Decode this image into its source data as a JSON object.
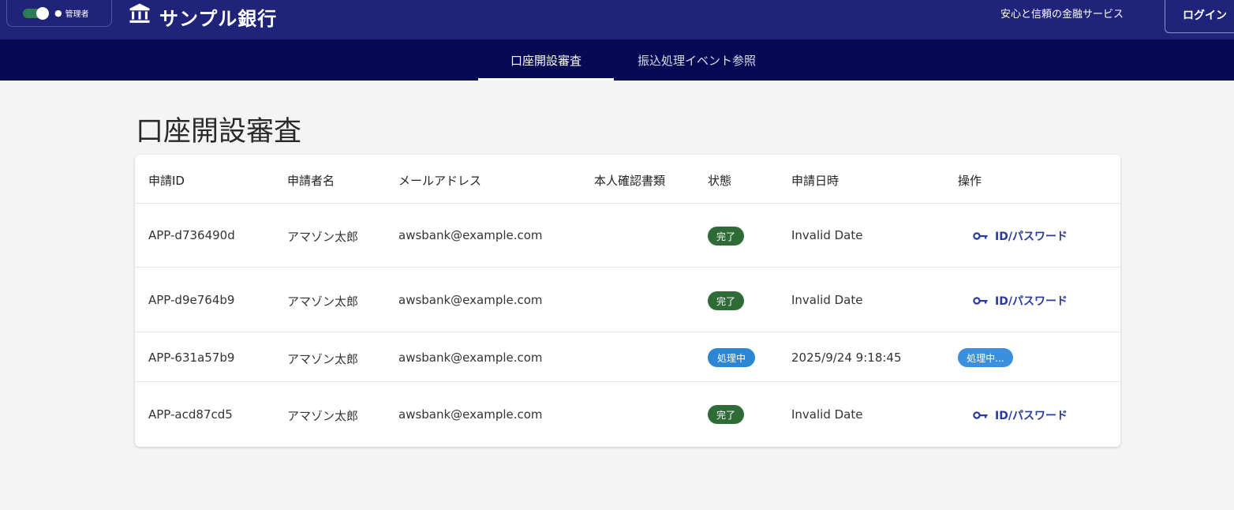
{
  "header": {
    "admin_label": "管理者",
    "brand": "サンプル銀行",
    "tagline": "安心と信頼の金融サービス",
    "login_label": "ログイン"
  },
  "nav": {
    "tabs": [
      {
        "label": "口座開設審査",
        "active": true
      },
      {
        "label": "振込処理イベント参照",
        "active": false
      }
    ]
  },
  "page": {
    "title": "口座開設審査"
  },
  "table": {
    "columns": [
      "申請ID",
      "申請者名",
      "メールアドレス",
      "本人確認書類",
      "状態",
      "申請日時",
      "操作"
    ],
    "rows": [
      {
        "id": "APP-d736490d",
        "name": "アマゾン太郎",
        "email": "awsbank@example.com",
        "doc": "",
        "status": "完了",
        "date": "Invalid Date",
        "action": "ID/パスワード"
      },
      {
        "id": "APP-d9e764b9",
        "name": "アマゾン太郎",
        "email": "awsbank@example.com",
        "doc": "",
        "status": "完了",
        "date": "Invalid Date",
        "action": "ID/パスワード"
      },
      {
        "id": "APP-631a57b9",
        "name": "アマゾン太郎",
        "email": "awsbank@example.com",
        "doc": "",
        "status": "処理中",
        "date": "2025/9/24 9:18:45",
        "action": "処理中..."
      },
      {
        "id": "APP-acd87cd5",
        "name": "アマゾン太郎",
        "email": "awsbank@example.com",
        "doc": "",
        "status": "完了",
        "date": "Invalid Date",
        "action": "ID/パスワード"
      }
    ]
  },
  "colors": {
    "header_bg": "#1f237a",
    "nav_bg": "#060a55",
    "status_done": "#2e6b36",
    "status_processing": "#2d86d4",
    "link": "#2a3a9c"
  },
  "icons": {
    "bank": "bank-icon",
    "key": "key-icon",
    "admin": "user-icon"
  }
}
